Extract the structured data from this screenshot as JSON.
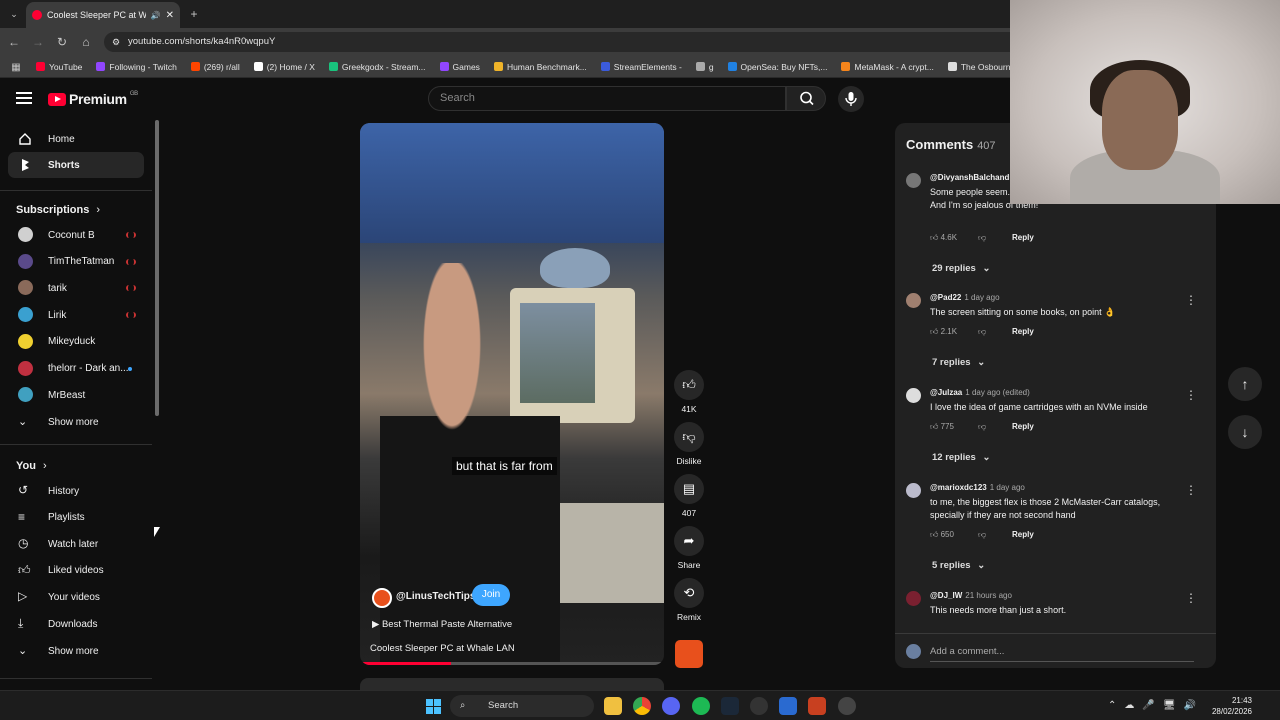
{
  "browser": {
    "tab_title": "Coolest Sleeper PC at Whale",
    "url": "youtube.com/shorts/ka4nR0wqpuY",
    "bookmarks": [
      {
        "label": "YouTube",
        "color": "#ff0033"
      },
      {
        "label": "Following - Twitch",
        "color": "#9146ff"
      },
      {
        "label": "(269) r/all",
        "color": "#ff4500"
      },
      {
        "label": "(2) Home / X",
        "color": "#ffffff"
      },
      {
        "label": "Greekgodx - Stream...",
        "color": "#19c37d"
      },
      {
        "label": "Games",
        "color": "#9146ff"
      },
      {
        "label": "Human Benchmark...",
        "color": "#f0b429"
      },
      {
        "label": "StreamElements -",
        "color": "#3b5bdb"
      },
      {
        "label": "g",
        "color": "#aaaaaa"
      },
      {
        "label": "OpenSea: Buy NFTs,...",
        "color": "#2081e2"
      },
      {
        "label": "MetaMask - A crypt...",
        "color": "#f6851b"
      },
      {
        "label": "The Osbournes - Se...",
        "color": "#dddddd"
      }
    ]
  },
  "header": {
    "logo_text": "Premium",
    "region": "GB",
    "search_placeholder": "Search"
  },
  "sidebar": {
    "home": "Home",
    "shorts": "Shorts",
    "subscriptions_heading": "Subscriptions",
    "subscriptions": [
      {
        "name": "Coconut B",
        "status": "live",
        "color": "#d0d0d0"
      },
      {
        "name": "TimTheTatman",
        "status": "live",
        "color": "#5a4a8a"
      },
      {
        "name": "tarik",
        "status": "live",
        "color": "#8a6a5a"
      },
      {
        "name": "Lirik",
        "status": "live",
        "color": "#3aa0d0"
      },
      {
        "name": "Mikeyduck",
        "status": "",
        "color": "#f0d030"
      },
      {
        "name": "thelorr - Dark an...",
        "status": "new",
        "color": "#c03040"
      },
      {
        "name": "MrBeast",
        "status": "",
        "color": "#40a0c0"
      }
    ],
    "show_more_1": "Show more",
    "you_heading": "You",
    "you_items": [
      "History",
      "Playlists",
      "Watch later",
      "Liked videos",
      "Your videos",
      "Downloads"
    ],
    "show_more_2": "Show more"
  },
  "video": {
    "caption": "but that is far from",
    "channel": "@LinusTechTips",
    "join_label": "Join",
    "related": "Best Thermal Paste Alternative",
    "title": "Coolest Sleeper PC at Whale LAN",
    "progress": 0.3
  },
  "actions": {
    "likes": "41K",
    "dislike": "Dislike",
    "comments": "407",
    "share": "Share",
    "remix": "Remix"
  },
  "comments": {
    "heading": "Comments",
    "count": "407",
    "items": [
      {
        "user": "@DivyanshBalchand",
        "time": "",
        "text": "Some people seem... swear...\nAnd I'm so jealous of them!",
        "likes": "4.6K",
        "replies": "29 replies",
        "color": "#777777"
      },
      {
        "user": "@Pad22",
        "time": "1 day ago",
        "text": "The screen sitting on some books, on point 👌",
        "likes": "2.1K",
        "replies": "7 replies",
        "color": "#a08070"
      },
      {
        "user": "@Julzaa",
        "time": "1 day ago (edited)",
        "text": "I love the idea of game cartridges with an NVMe inside",
        "likes": "775",
        "replies": "12 replies",
        "color": "#dddddd"
      },
      {
        "user": "@marioxdc123",
        "time": "1 day ago",
        "text": "to me, the biggest flex is those 2 McMaster-Carr catalogs, specially if they are not second hand",
        "likes": "650",
        "replies": "5 replies",
        "color": "#bbbbcc"
      },
      {
        "user": "@DJ_IW",
        "time": "21 hours ago",
        "text": "This needs more than just a short.",
        "likes": "",
        "replies": "",
        "color": "#7a2030"
      }
    ],
    "reply_label": "Reply",
    "add_placeholder": "Add a comment..."
  },
  "taskbar": {
    "search": "Search",
    "time": "21:43",
    "date": "28/02/2026"
  }
}
